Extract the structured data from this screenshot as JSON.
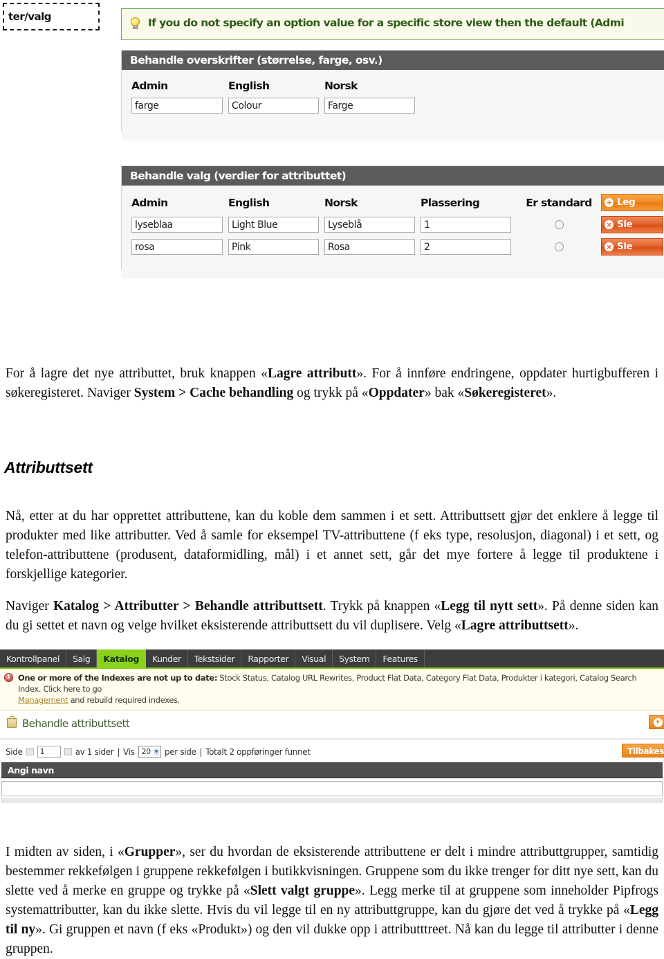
{
  "screenshot_top": {
    "breadcrumb_box": "ter/valg",
    "notice": {
      "icon": "lightbulb-icon",
      "text": "If you do not specify an option value for a specific store view then the default (Admi"
    },
    "labels_panel": {
      "title": "Behandle overskrifter (størrelse, farge, osv.)",
      "columns": [
        "Admin",
        "English",
        "Norsk"
      ],
      "row": [
        "farge",
        "Colour",
        "Farge"
      ]
    },
    "options_panel": {
      "title": "Behandle valg (verdier for attributtet)",
      "columns": [
        "Admin",
        "English",
        "Norsk",
        "Plassering",
        "Er standard"
      ],
      "add_button": "Leg",
      "delete_button": "Sle",
      "rows": [
        {
          "admin": "lyseblaa",
          "english": "Light Blue",
          "norsk": "Lyseblå",
          "plassering": "1",
          "er_standard": false
        },
        {
          "admin": "rosa",
          "english": "Pink",
          "norsk": "Rosa",
          "plassering": "2",
          "er_standard": false
        }
      ]
    }
  },
  "paragraphs": {
    "p1_a": "For å lagre det nye attributtet, bruk knappen «",
    "p1_b": "Lagre attributt",
    "p1_c": "». For å innføre endringene, oppdater hurtigbufferen i søkeregisteret. Naviger ",
    "p1_d": "System > Cache behandling",
    "p1_e": " og trykk på «",
    "p1_f": "Oppdater",
    "p1_g": "» bak «",
    "p1_h": "Søkeregisteret",
    "p1_i": "».",
    "heading": "Attributtsett",
    "p2": "Nå, etter at du har opprettet attributtene, kan du koble dem sammen i et sett. Attributtsett gjør det enklere å legge til produkter med like attributter. Ved å samle for eksempel TV-attributtene (f eks type, resolusjon, diagonal) i et sett, og telefon-attributtene (produsent, dataformidling, mål) i et annet sett, går det mye fortere å legge til produktene i forskjellige kategorier.",
    "p3_a": "Naviger ",
    "p3_b": "Katalog > Attributter > Behandle attributtsett",
    "p3_c": ". Trykk på knappen «",
    "p3_d": "Legg til nytt sett",
    "p3_e": "». På denne siden kan du gi settet et navn og velge hvilket eksisterende attributtsett du vil duplisere. Velg «",
    "p3_f": "Lagre attributtsett",
    "p3_g": "».",
    "p4_a": "I midten av siden, i «",
    "p4_b": "Grupper",
    "p4_c": "», ser du hvordan de eksisterende attributtene er delt i mindre attributtgrupper, samtidig bestemmer rekkefølgen i gruppene rekkefølgen i butikkvisningen. Gruppene som du ikke trenger for ditt nye sett, kan du slette ved å merke en gruppe og trykke på «",
    "p4_d": "Slett valgt gruppe",
    "p4_e": "». Legg merke til at gruppene som inneholder Pipfrogs systemattributter, kan du ikke slette. Hvis du vil legge til en ny attributtgruppe, kan du gjøre det ved å trykke på «",
    "p4_f": "Legg til ny",
    "p4_g": "». Gi gruppen et navn (f eks «Produkt») og den vil dukke opp i attributttreet. Nå kan du legge til attributter i denne gruppen."
  },
  "screenshot_bottom": {
    "tabs": [
      {
        "label": "Kontrollpanel",
        "active": false
      },
      {
        "label": "Salg",
        "active": false
      },
      {
        "label": "Katalog",
        "active": true
      },
      {
        "label": "Kunder",
        "active": false
      },
      {
        "label": "Tekstsider",
        "active": false
      },
      {
        "label": "Rapporter",
        "active": false
      },
      {
        "label": "Visual",
        "active": false
      },
      {
        "label": "System",
        "active": false
      },
      {
        "label": "Features",
        "active": false
      }
    ],
    "index_notice": {
      "icon": "error-icon",
      "strong": "One or more of the Indexes are not up to date:",
      "rest": " Stock Status, Catalog URL Rewrites, Product Flat Data, Category Flat Data, Produkter i kategori, Catalog Search Index. Click here to go",
      "link": "Management",
      "tail": " and rebuild required indexes."
    },
    "page_title": "Behandle attributtsett",
    "add_button_icon": "plus-icon",
    "pager": {
      "side_label": "Side",
      "page_value": "1",
      "of_label": "av 1 sider",
      "sep": "|",
      "vis_label": "Vis",
      "per_page_value": "20",
      "per_page_label": "per side",
      "sep2": "|",
      "total_label": "Totalt 2 oppføringer funnet",
      "back_button": "Tilbakes"
    },
    "grid_header": "Angi navn"
  }
}
